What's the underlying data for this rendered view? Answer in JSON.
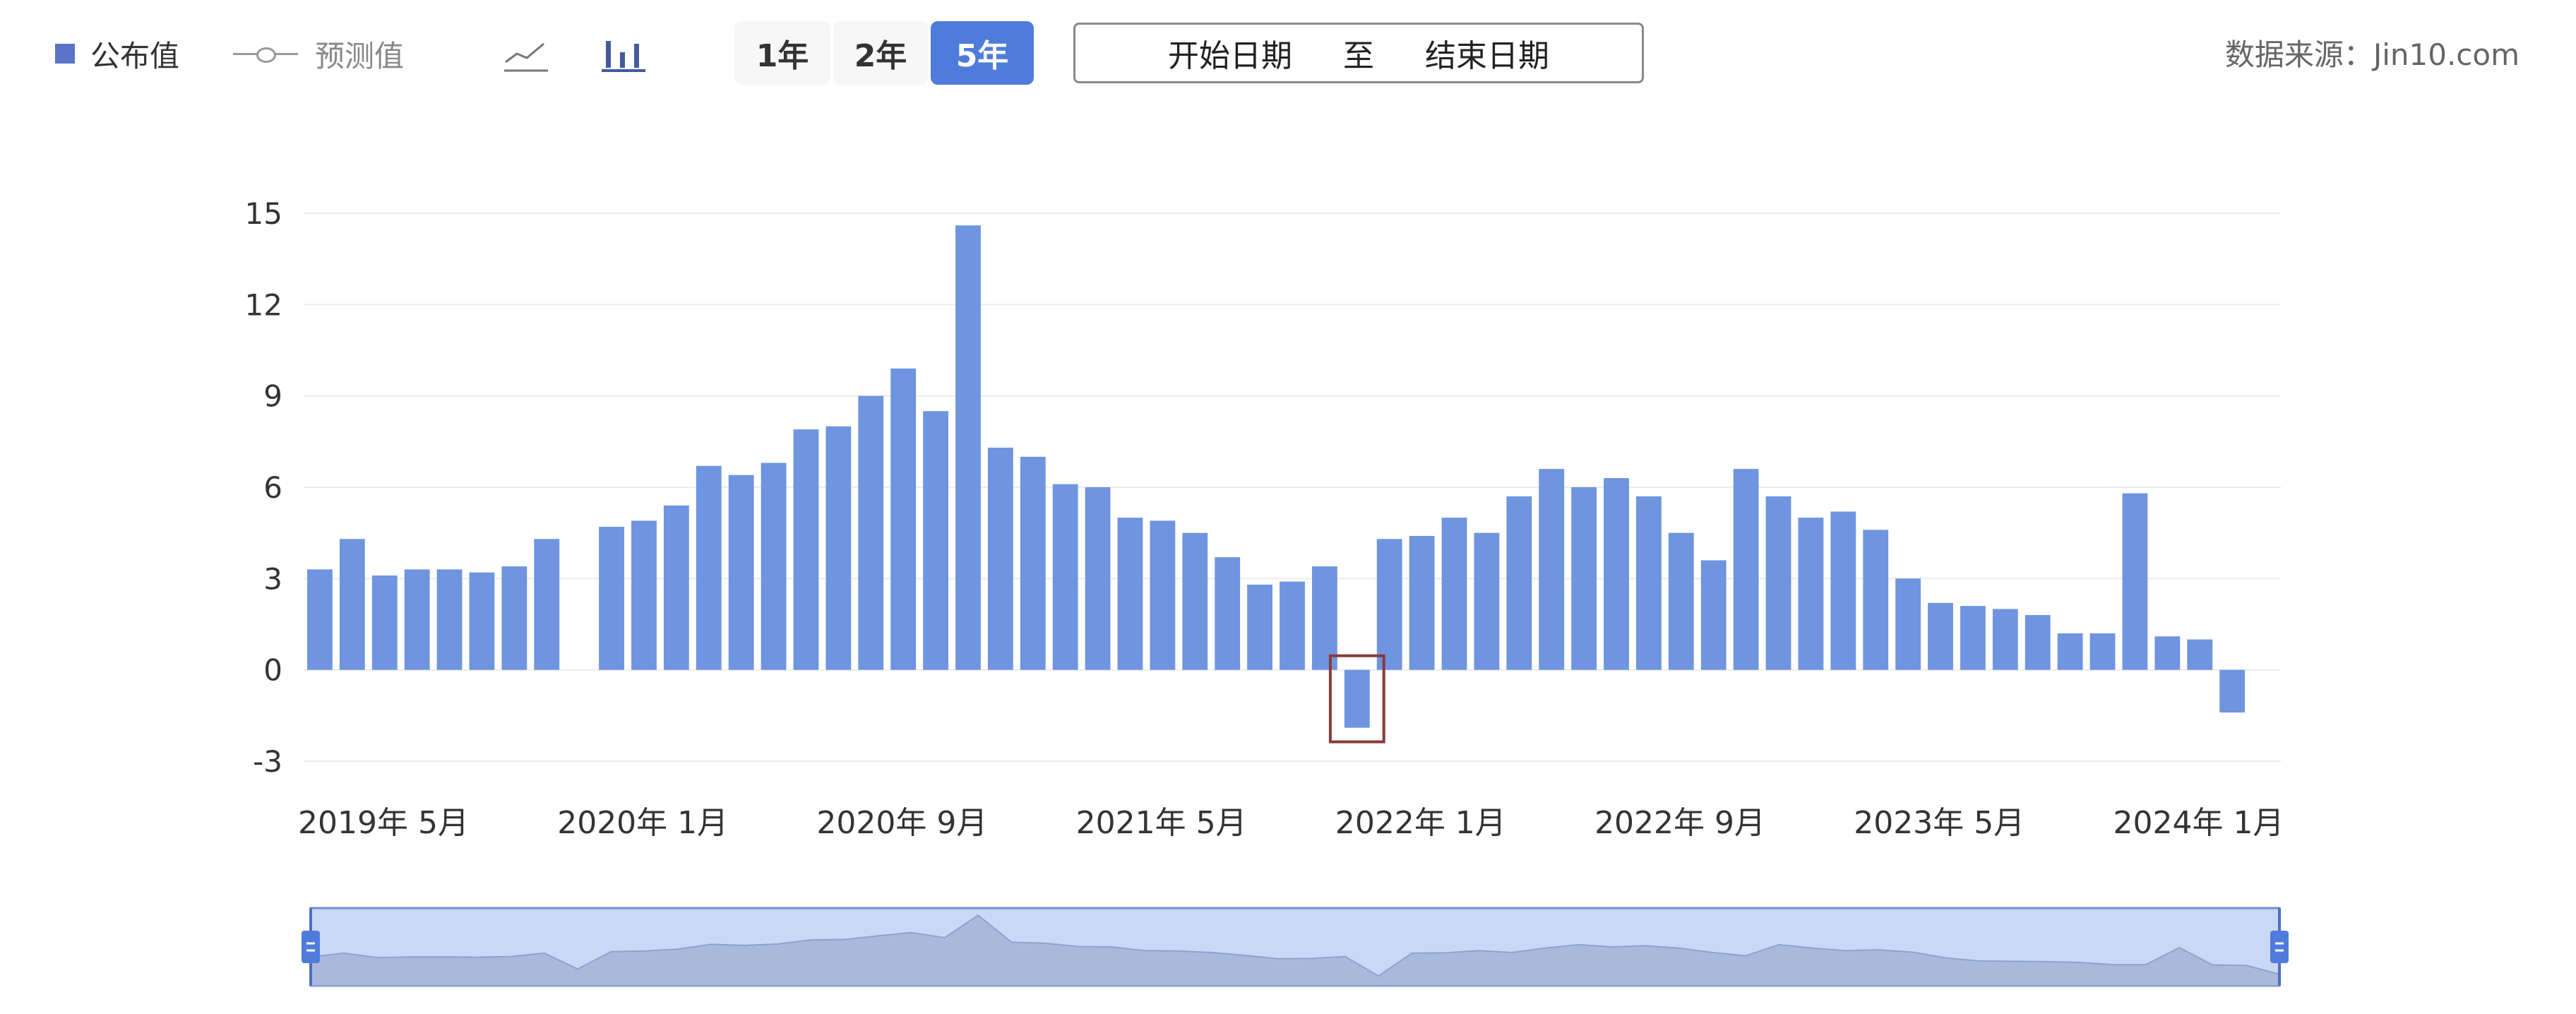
{
  "toolbar": {
    "legend": [
      {
        "label": "公布值",
        "color": "#5b73c9"
      },
      {
        "label": "预测值",
        "color": "#999999"
      }
    ],
    "chart_type_icons": [
      "line-chart-icon",
      "bar-chart-icon"
    ],
    "range_buttons": [
      {
        "label": "1年",
        "active": false
      },
      {
        "label": "2年",
        "active": false
      },
      {
        "label": "5年",
        "active": true
      }
    ],
    "date_range": {
      "start": "开始日期",
      "sep": "至",
      "end": "结束日期"
    },
    "source": "数据来源：Jin10.com"
  },
  "chart_data": {
    "type": "bar",
    "title": "",
    "xlabel": "",
    "ylabel": "",
    "ylim": [
      -3,
      15
    ],
    "yticks": [
      -3,
      0,
      3,
      6,
      9,
      12,
      15
    ],
    "grid": true,
    "bar_color": "#6f94e0",
    "highlight_color": "#8b3a3a",
    "x_tick_labels": [
      {
        "index": 0,
        "label": "2019年 5月"
      },
      {
        "index": 8,
        "label": "2020年 1月"
      },
      {
        "index": 16,
        "label": "2020年 9月"
      },
      {
        "index": 24,
        "label": "2021年 5月"
      },
      {
        "index": 32,
        "label": "2022年 1月"
      },
      {
        "index": 40,
        "label": "2022年 9月"
      },
      {
        "index": 48,
        "label": "2023年 5月"
      },
      {
        "index": 56,
        "label": "2024年 1月"
      }
    ],
    "categories": [
      "2019-05",
      "2019-06",
      "2019-07",
      "2019-08",
      "2019-09",
      "2019-10",
      "2019-11",
      "2019-12",
      "2020-01",
      "2020-02",
      "2020-03",
      "2020-04",
      "2020-05",
      "2020-06",
      "2020-07",
      "2020-08",
      "2020-09",
      "2020-10",
      "2020-11",
      "2020-12",
      "2021-01",
      "2021-02",
      "2021-03",
      "2021-04",
      "2021-05",
      "2021-06",
      "2021-07",
      "2021-08",
      "2021-09",
      "2021-10",
      "2021-11",
      "2021-12",
      "2022-01",
      "2022-02",
      "2022-03",
      "2022-04",
      "2022-05",
      "2022-06",
      "2022-07",
      "2022-08",
      "2022-09",
      "2022-10",
      "2022-11",
      "2022-12",
      "2023-01",
      "2023-02",
      "2023-03",
      "2023-04",
      "2023-05",
      "2023-06",
      "2023-07",
      "2023-08",
      "2023-09",
      "2023-10",
      "2023-11",
      "2023-12",
      "2024-01",
      "2024-02",
      "2024-03",
      "2024-04",
      "2024-05"
    ],
    "values": [
      3.3,
      4.3,
      3.1,
      3.3,
      3.3,
      3.2,
      3.4,
      4.3,
      null,
      4.7,
      4.9,
      5.4,
      6.7,
      6.4,
      6.8,
      7.9,
      8.0,
      9.0,
      9.9,
      8.5,
      14.6,
      7.3,
      7.0,
      6.1,
      6.0,
      5.0,
      4.9,
      4.5,
      3.7,
      2.8,
      2.9,
      3.4,
      -1.9,
      4.3,
      4.4,
      5.0,
      4.5,
      5.7,
      6.6,
      6.0,
      6.3,
      5.7,
      4.5,
      3.6,
      6.6,
      5.7,
      5.0,
      5.2,
      4.6,
      3.0,
      2.2,
      2.1,
      2.0,
      1.8,
      1.2,
      1.2,
      5.8,
      1.1,
      1.0,
      -1.4
    ],
    "highlighted_categories": [
      "2022-01",
      "2024-05"
    ]
  }
}
